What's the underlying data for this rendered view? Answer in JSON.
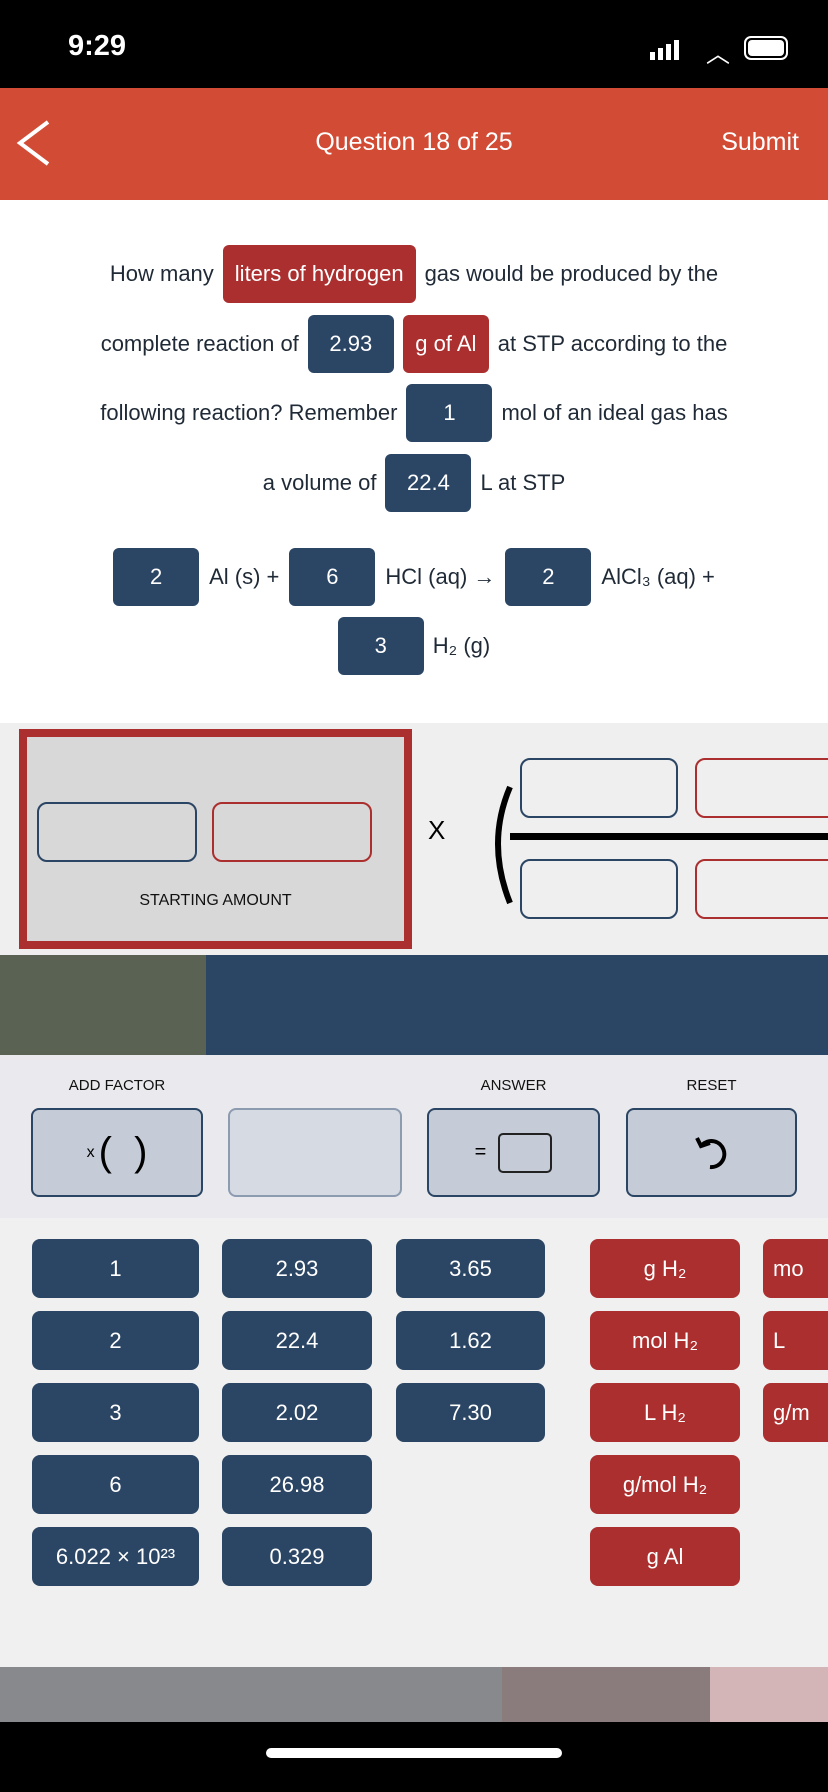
{
  "status": {
    "time": "9:29"
  },
  "header": {
    "title": "Question 18 of 25",
    "submit": "Submit"
  },
  "question": {
    "l1": {
      "t1": "How many",
      "c1": "liters of hydrogen",
      "t2": "gas would be produced by the"
    },
    "l2": {
      "t1": "complete reaction of",
      "c1": "2.93",
      "c2": "g of Al",
      "t2": "at STP according to the"
    },
    "l3": {
      "t1": "following reaction? Remember",
      "c1": "1",
      "t2": "mol of an ideal gas has"
    },
    "l4": {
      "t1": "a volume of",
      "c1": "22.4",
      "t2": "L at STP"
    },
    "eq1": {
      "c1": "2",
      "t1": "Al (s) +",
      "c2": "6",
      "t2": "HCl (aq) →",
      "c3": "2",
      "t3": "AlCl₃ (aq) +"
    },
    "eq2": {
      "c1": "3",
      "t1": "H₂ (g)"
    }
  },
  "work": {
    "starting_label": "STARTING AMOUNT",
    "times": "X"
  },
  "toolbar": {
    "add_factor": "ADD FACTOR",
    "answer": "ANSWER",
    "reset": "RESET",
    "factor_symbol": "x",
    "equals": "="
  },
  "tiles": {
    "numbers": [
      [
        "1",
        "2",
        "3",
        "6",
        "6.022 × 10²³"
      ],
      [
        "2.93",
        "22.4",
        "2.02",
        "26.98",
        "0.329"
      ],
      [
        "3.65",
        "1.62",
        "7.30"
      ]
    ],
    "units": [
      "g H₂",
      "mol H₂",
      "L H₂",
      "g/mol H₂",
      "g Al"
    ],
    "units_cut": [
      "mo",
      "L",
      "g/m"
    ]
  },
  "colors": {
    "header": "#d24b35",
    "blue": "#2b4564",
    "red": "#ab2f2f"
  }
}
